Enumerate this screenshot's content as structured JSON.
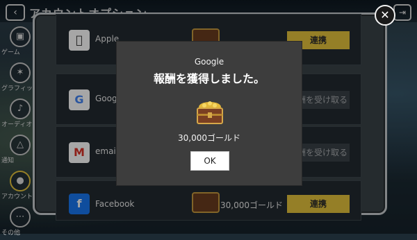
{
  "topbar": {
    "title": "アカウントオプション",
    "back_icon": "back-arrow-icon",
    "exit_icon": "exit-icon"
  },
  "nav": {
    "items": [
      {
        "label": "ゲーム",
        "icon": "gamepad-icon"
      },
      {
        "label": "グラフィック",
        "icon": "palette-icon"
      },
      {
        "label": "オーディオ",
        "icon": "speaker-icon"
      },
      {
        "label": "通知",
        "icon": "bell-icon"
      },
      {
        "label": "アカウント",
        "icon": "person-icon"
      },
      {
        "label": "その他",
        "icon": "more-icon"
      }
    ]
  },
  "accounts": {
    "rows": [
      {
        "name": "Apple",
        "reward": "",
        "button": "連携",
        "icon": "apple-icon"
      },
      {
        "name": "Google",
        "reward": "",
        "button": "報酬を受け取る",
        "icon": "google-icon"
      },
      {
        "name": "email",
        "reward": "",
        "button": "報酬を受け取る",
        "icon": "mail-icon"
      },
      {
        "name": "Facebook",
        "reward": "30,000ゴールド",
        "button": "連携",
        "icon": "facebook-icon"
      }
    ]
  },
  "modal": {
    "provider": "Google",
    "title": "報酬を獲得しました。",
    "reward": "30,000ゴールド",
    "ok_label": "OK"
  },
  "colors": {
    "accent_button": "#e5c33d",
    "modal_bg": "#3d3d3d",
    "frame_border": "#c8cdd0"
  }
}
